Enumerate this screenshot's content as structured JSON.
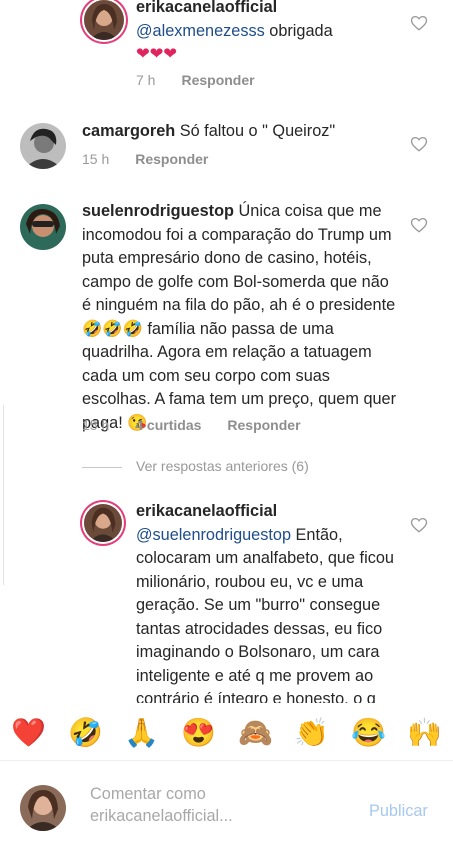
{
  "comments": [
    {
      "username": "erikacanelaofficial",
      "mention": "@alexmenezesss",
      "text": " obrigada",
      "hearts": "❤❤❤",
      "time": "7 h",
      "reply": "Responder"
    },
    {
      "username": "camargoreh",
      "text": " Só faltou o \" Queiroz\"",
      "time": "15 h",
      "reply": "Responder"
    },
    {
      "username": "suelenrodriguestop",
      "text": " Única coisa que me incomodou foi a comparação do Trump um puta empresário dono de casino, hotéis, campo de golfe com Bol-somerda que não é ninguém na fila do pão, ah é o presidente 🤣🤣🤣 família não passa de uma quadrilha. Agora em relação a tatuagem cada um com seu corpo com suas escolhas. A fama tem um preço, quem quer paga! 😘",
      "time": "15 h",
      "likes": "4 curtidas",
      "reply": "Responder"
    },
    {
      "username": "erikacanelaofficial",
      "mention": "@suelenrodriguestop",
      "text": " Então, colocaram um analfabeto,  que ficou milionário, roubou eu, vc e  uma geração. Se um \"burro\" consegue tantas atrocidades dessas, eu fico imaginando o Bolsonaro, um cara inteligente e até q me provem ao contrário é íntegro e honesto, o q ele pode"
    }
  ],
  "view_previous_replies": "Ver respostas anteriores (6)",
  "emoji_bar": [
    "❤️",
    "🤣",
    "🙏",
    "😍",
    "🙈",
    "👏",
    "😂",
    "🙌"
  ],
  "composer": {
    "placeholder": "Comentar como\nerikacanelaofficial...",
    "publish_label": "Publicar"
  },
  "colors": {
    "mention": "#1f4d8c",
    "meta_text": "#9a9a9a",
    "publish": "#a7c8ef"
  }
}
